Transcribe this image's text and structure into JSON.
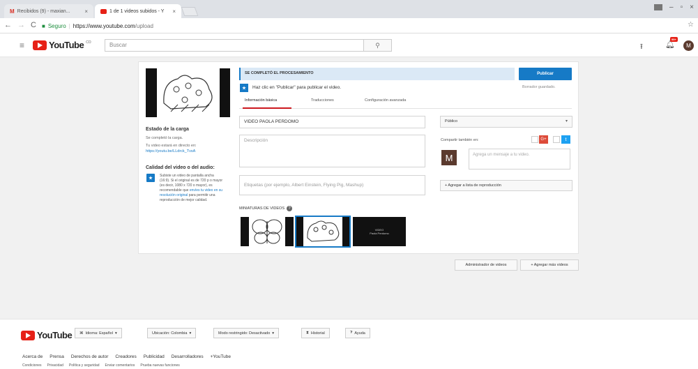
{
  "browser": {
    "tabs": [
      {
        "label": "Recibidos (9) - maxian...",
        "icon": "gmail-icon",
        "active": false
      },
      {
        "label": "1 de 1 videos subidos - Y",
        "icon": "youtube-tab-icon",
        "active": true
      }
    ],
    "secure_label": "Seguro",
    "url_host": "https://www.youtube.com",
    "url_path": "/upload"
  },
  "header": {
    "logo_text": "YouTube",
    "logo_suffix": "CO",
    "search_placeholder": "Buscar",
    "avatar_letter": "M",
    "notification_badge": "99+"
  },
  "upload": {
    "state_title": "Estado de la carga",
    "state_line": "Se completó la carga.",
    "link_label": "Tu video estará en directo en:",
    "link_url": "https://youtu.be/LLdrck_TvsA",
    "quality_title": "Calidad del video o del audio:",
    "quality_text_1": "Subiste un video de pantalla ancha (16:9). Si el original es de 720 p o mayor (es decir, 1080 x 720 o mayor), es recomendable que ",
    "quality_link": "envíes tu video en su resolución original",
    "quality_text_2": " para permitir una reproducción de mejor calidad.",
    "processing_status": "SE COMPLETÓ EL PROCESAMIENTO",
    "publish_label": "Publicar",
    "draft_saved": "Borrador guardado.",
    "hint": "Haz clic en \"Publicar\" para publicar el video.",
    "tabs": [
      "Información básica",
      "Traducciones",
      "Configuración avanzada"
    ],
    "title_value": "VIDEO   PAOLA PERDOMO",
    "description_placeholder": "Descripción",
    "tags_placeholder": "Etiquetas (por ejemplo, Albert Einstein, Flying Pig, Mashup)",
    "thumbnails_label": "MINIATURAS DE VIDEOS",
    "thumb3_text": "VIDEO\nPaola Perdomo",
    "privacy_value": "Público",
    "share_label": "Compartir también en:",
    "gplus_label": "G+",
    "twitter_label": "t",
    "message_avatar_letter": "M",
    "message_placeholder": "Agrega un mensaje a tu video.",
    "playlist_label": "+ Agregar a lista de reproducción",
    "manage_label": "Administrador de videos",
    "add_more_label": "+ Agregar más videos"
  },
  "footer": {
    "logo_text": "YouTube",
    "language_btn": "Idioma: Español",
    "location_btn": "Ubicación: Colombia",
    "restricted_btn": "Modo restringido: Desactivado",
    "history_btn": "Historial",
    "help_btn": "Ayuda",
    "links_row1": [
      "Acerca de",
      "Prensa",
      "Derechos de autor",
      "Creadores",
      "Publicidad",
      "Desarrolladores",
      "+YouTube"
    ],
    "links_row2": [
      "Condiciones",
      "Privacidad",
      "Política y seguridad",
      "Enviar comentarios",
      "Prueba nuevas funciones"
    ]
  },
  "colors": {
    "accent": "#167ac6",
    "brand": "#e62117",
    "processing_bg": "#dbe9f6"
  }
}
